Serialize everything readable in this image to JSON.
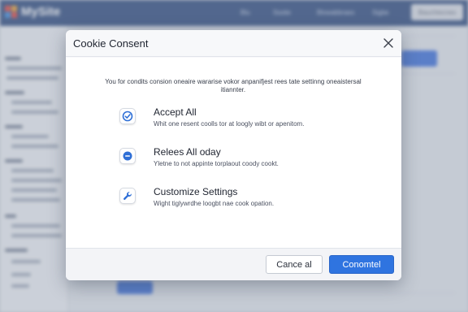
{
  "background": {
    "logo_text": "MySite",
    "nav_items": [
      "Blu",
      "Ssstie",
      "Blowabbraes",
      "Sigbe"
    ],
    "header_button": "Bauchtecnes",
    "colors": {
      "header": "#2f4b7e",
      "accent": "#3d6fd8"
    }
  },
  "modal": {
    "title": "Cookie Consent",
    "close_icon": "close-icon",
    "intro": "You for condits consion oneaire wararise vokor anpanifjest rees tate settinng oneaistersal itiannter.",
    "options": [
      {
        "icon": "cookie-check-icon",
        "title": "Accept All",
        "description": "Whit one resent coolls tor at loogly wibt or apenitom."
      },
      {
        "icon": "cookie-reject-icon",
        "title": "Relees All oday",
        "description": "Yletne to not appinte torplaout coody cookt."
      },
      {
        "icon": "settings-wrench-icon",
        "title": "Customize Settings",
        "description": "Wight tiglywrdhe loogbt nae cook opation."
      }
    ],
    "buttons": {
      "cancel": "Cance al",
      "confirm": "Conomtel"
    },
    "colors": {
      "primary_button": "#2f74e0",
      "icon_blue": "#2f6fd6"
    }
  }
}
